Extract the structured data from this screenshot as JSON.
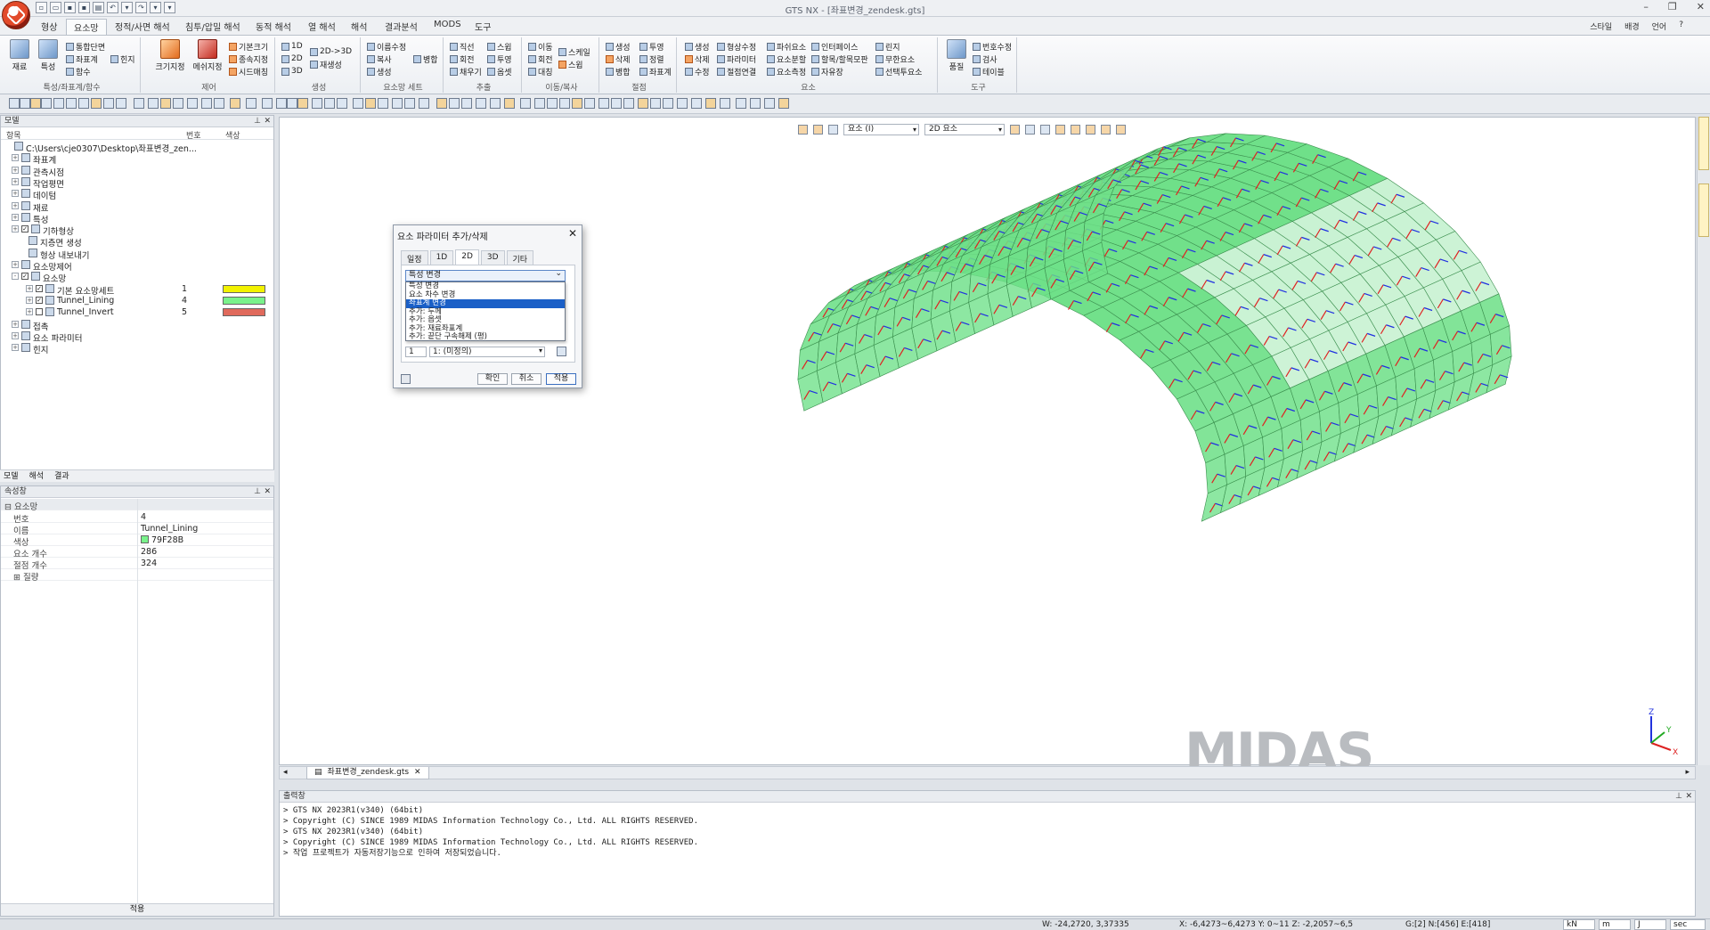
{
  "window": {
    "title": "GTS NX - [좌표변경_zendesk.gts]"
  },
  "ribbon_tabs": [
    "형상",
    "요소망",
    "정적/사면 해석",
    "침투/압밀 해석",
    "동적 해석",
    "열 해석",
    "해석",
    "결과분석",
    "MODS",
    "도구"
  ],
  "ribbon_active": "요소망",
  "right_tabs": [
    "스타일",
    "배경",
    "언어"
  ],
  "ribbon_groups": [
    {
      "title": "특성/좌표계/함수",
      "big": [
        "재료",
        "특성"
      ],
      "small": [
        "통합단면",
        "좌표계",
        "함수",
        "힌지"
      ]
    },
    {
      "title": "제어",
      "big": [
        "크기지정",
        "메쉬지정"
      ],
      "small": [
        "기본크기",
        "종속지정",
        "시드매칭"
      ]
    },
    {
      "title": "생성",
      "small": [
        "1D",
        "2D",
        "3D",
        "2D->3D",
        "재생성"
      ]
    },
    {
      "title": "요소망 세트",
      "small": [
        "이름수정",
        "복사",
        "생성",
        "병합"
      ]
    },
    {
      "title": "추출",
      "small": [
        "직선",
        "회전",
        "채우기",
        "스윕",
        "투영",
        "옵셋"
      ]
    },
    {
      "title": "이동/복사",
      "small": [
        "이동",
        "회전",
        "대칭",
        "스케일",
        "스윕"
      ]
    },
    {
      "title": "절점",
      "small": [
        "생성",
        "삭제",
        "병합",
        "투영",
        "정렬",
        "좌표계"
      ]
    },
    {
      "title": "요소",
      "small": [
        "생성",
        "삭제",
        "수정",
        "형상수정",
        "파라미터",
        "절점연결",
        "파쉬요소",
        "요소분할",
        "요소측정",
        "인터페이스",
        "할목/할목모판",
        "자유장",
        "린지",
        "무한요소",
        "선택투요소"
      ]
    },
    {
      "title": "도구",
      "big": [
        "품질"
      ],
      "small": [
        "번호수정",
        "검사",
        "테이블"
      ]
    }
  ],
  "model_panel": {
    "title": "모델",
    "columns": [
      "항목",
      "번호",
      "색상"
    ],
    "rows": [
      {
        "label": "C:\\Users\\cje0307\\Desktop\\좌표변경_zen...",
        "indent": 0,
        "expand": ""
      },
      {
        "label": "좌표계",
        "indent": 1,
        "expand": "+"
      },
      {
        "label": "관측시점",
        "indent": 1,
        "expand": "+"
      },
      {
        "label": "작업평면",
        "indent": 1,
        "expand": "+"
      },
      {
        "label": "데이텀",
        "indent": 1,
        "expand": "+"
      },
      {
        "label": "재료",
        "indent": 1,
        "expand": "+"
      },
      {
        "label": "특성",
        "indent": 1,
        "expand": "+"
      },
      {
        "label": "기하형상",
        "indent": 1,
        "expand": "+",
        "check": true
      },
      {
        "label": "지층면 생성",
        "indent": 2,
        "expand": ""
      },
      {
        "label": "형상 내보내기",
        "indent": 2,
        "expand": ""
      },
      {
        "label": "요소망제어",
        "indent": 1,
        "expand": "+"
      },
      {
        "label": "요소망",
        "indent": 1,
        "expand": "-",
        "check": true
      },
      {
        "label": "기본 요소망세트",
        "indent": 3,
        "expand": "+",
        "check": true,
        "num": "1",
        "color": "#f2f200"
      },
      {
        "label": "Tunnel_Lining",
        "indent": 3,
        "expand": "+",
        "check": true,
        "num": "4",
        "color": "#79f28b"
      },
      {
        "label": "Tunnel_Invert",
        "indent": 3,
        "expand": "+",
        "check": false,
        "num": "5",
        "color": "#e06a5c"
      },
      {
        "label": "접촉",
        "indent": 1,
        "expand": "+"
      },
      {
        "label": "요소 파라미터",
        "indent": 1,
        "expand": "+"
      },
      {
        "label": "힌지",
        "indent": 1,
        "expand": "+"
      }
    ],
    "subtabs": [
      "모델",
      "해석",
      "결과"
    ]
  },
  "property_panel": {
    "title": "속성창",
    "section": "요소망",
    "rows": [
      {
        "k": "번호",
        "v": "4"
      },
      {
        "k": "이름",
        "v": "Tunnel_Lining"
      },
      {
        "k": "색상",
        "v": "79F28B",
        "swatch": "#79f28b"
      },
      {
        "k": "요소 개수",
        "v": "286"
      },
      {
        "k": "절점 개수",
        "v": "324"
      }
    ],
    "collapsed_section": "질량",
    "apply": "적용"
  },
  "viewport_toolbar": {
    "combo1": "요소 (I)",
    "combo2": "2D 요소"
  },
  "dialog": {
    "title": "요소 파라미터 추가/삭제",
    "tabs": [
      "일정",
      "1D",
      "2D",
      "3D",
      "기타"
    ],
    "active_tab": "2D",
    "selected": "특성 변경",
    "options": [
      "특성 변경",
      "요소 차수 변경",
      "좌표계 변경",
      "추가: 두께",
      "추가: 옵셋",
      "추가: 재료좌표계",
      "추가: 끝단 구속해제 (평)"
    ],
    "highlight_index": 2,
    "field1": "1",
    "field2": "1: (미정의)",
    "buttons": [
      "확인",
      "취소",
      "적용"
    ]
  },
  "file_tab": "좌표변경_zendesk.gts",
  "output": {
    "title": "출력창",
    "lines": [
      "> GTS NX 2023R1(v340) (64bit)",
      "> Copyright (C) SINCE 1989 MIDAS Information Technology Co., Ltd. ALL RIGHTS RESERVED.",
      "> GTS NX 2023R1(v340) (64bit)",
      "> Copyright (C) SINCE 1989 MIDAS Information Technology Co., Ltd. ALL RIGHTS RESERVED.",
      "> 작업 프로젝트가 자동저장기능으로 인하여 저장되었습니다."
    ]
  },
  "watermark": "MIDAS",
  "status": {
    "w": "W: -24,2720, 3,37335",
    "xy": "X: -6,4273~6,4273 Y: 0~11 Z: -2,2057~6,5",
    "g": "G:[2] N:[456] E:[418]",
    "units": [
      "kN",
      "m",
      "J",
      "sec"
    ]
  },
  "axis": {
    "x": "X",
    "y": "Y",
    "z": "Z"
  },
  "colors": {
    "mesh": "#6fe089",
    "mesh_light": "#c8f2d2",
    "accent": "#1a5fc7"
  }
}
